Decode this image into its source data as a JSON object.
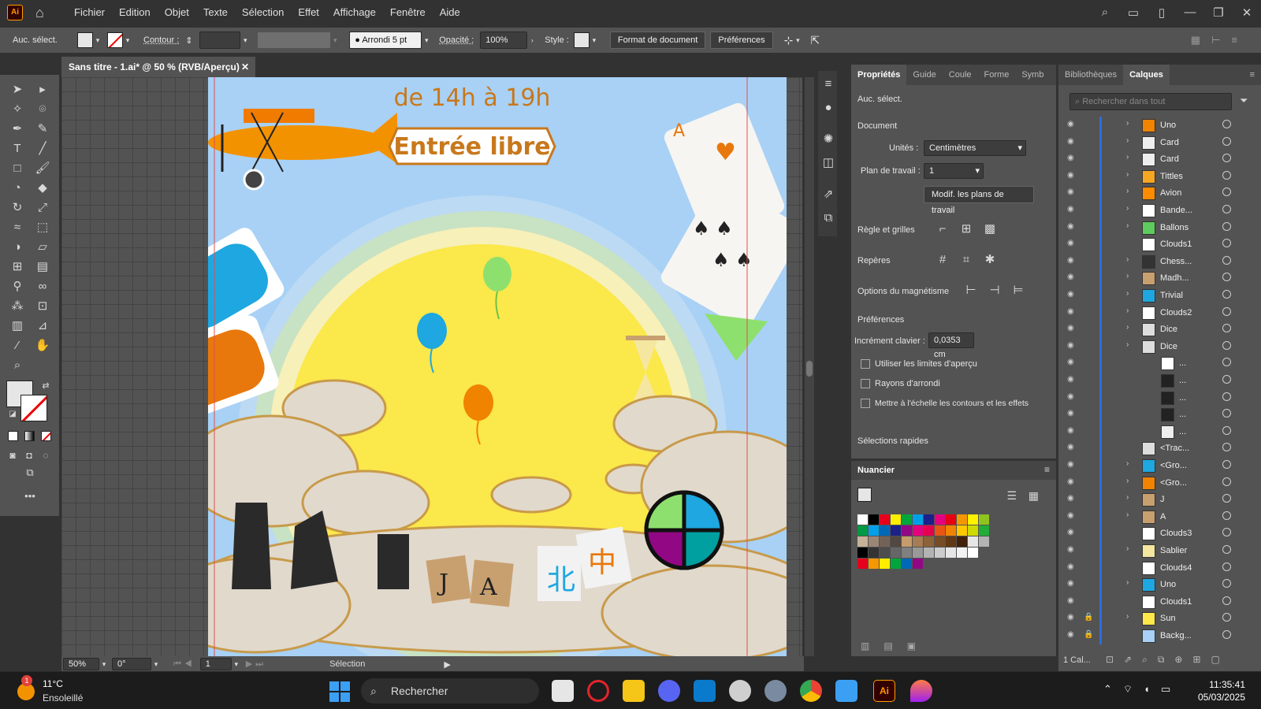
{
  "app": {
    "logo": "Ai",
    "menus": [
      "Fichier",
      "Edition",
      "Objet",
      "Texte",
      "Sélection",
      "Effet",
      "Affichage",
      "Fenêtre",
      "Aide"
    ]
  },
  "control": {
    "selection": "Auc. sélect.",
    "stroke_label": "Contour :",
    "brush": "Arrondi 5 pt",
    "opacity_label": "Opacité :",
    "opacity": "100%",
    "style_label": "Style :",
    "doc_format": "Format de document",
    "prefs": "Préférences"
  },
  "document": {
    "tab": "Sans titre - 1.ai* @ 50 % (RVB/Aperçu)"
  },
  "artwork": {
    "time": "de 14h à 19h",
    "banner": "Entrée libre",
    "tiles": [
      "J",
      "A"
    ],
    "hanzi": [
      "北",
      "中"
    ]
  },
  "status": {
    "zoom": "50%",
    "rotation": "0°",
    "artboard": "1",
    "tool": "Sélection"
  },
  "properties": {
    "tabs": [
      "Propriétés",
      "Guide",
      "Coule",
      "Forme",
      "Symb"
    ],
    "no_sel": "Auc. sélect.",
    "document": "Document",
    "units_label": "Unités :",
    "units": "Centimètres",
    "artboard_label": "Plan de travail :",
    "artboard": "1",
    "edit_artboards": "Modif. les plans de travail",
    "rulers": "Règle et grilles",
    "guides": "Repères",
    "snap": "Options du magnétisme",
    "prefs": "Préférences",
    "key_inc_label": "Incrément clavier :",
    "key_inc": "0,0353 cm",
    "checks": [
      "Utiliser les limites d'aperçu",
      "Rayons d'arrondi",
      "Mettre à l'échelle les contours et les effets"
    ],
    "quick": "Sélections rapides"
  },
  "swatches": {
    "title": "Nuancier",
    "row1": [
      "#ffffff",
      "#000000",
      "#e6001e",
      "#ffed00",
      "#00a63c",
      "#00a0e9",
      "#1d2088",
      "#e4007f",
      "#e60012",
      "#f39800",
      "#fff100",
      "#8fc31f"
    ],
    "row2": [
      "#009944",
      "#00a0e9",
      "#0068b7",
      "#1d2088",
      "#920783",
      "#e4007f",
      "#e5004f",
      "#ea5514",
      "#f08300",
      "#fcc800",
      "#cfdb00",
      "#22ac38"
    ],
    "row3": [
      "#c7b299",
      "#998675",
      "#736357",
      "#534741",
      "#c69c6d",
      "#a67c52",
      "#8c6239",
      "#754c24",
      "#603813",
      "#42210b",
      "#e6e6e6",
      "#b3b3b3"
    ],
    "row4": [
      "#000000",
      "#333333",
      "#4d4d4d",
      "#666666",
      "#808080",
      "#999999",
      "#b3b3b3",
      "#cccccc",
      "#e6e6e6",
      "#f2f2f2",
      "#ffffff"
    ],
    "row5": [
      "#e6001e",
      "#f39800",
      "#ffed00",
      "#00a63c",
      "#0068b7",
      "#920783"
    ]
  },
  "layers_panel": {
    "tabs": [
      "Bibliothèques",
      "Calques"
    ],
    "search": "Rechercher dans tout",
    "count": "1 Cal...",
    "items": [
      {
        "name": "Uno",
        "exp": true,
        "sub": false,
        "c": "#f08300",
        "lock": false
      },
      {
        "name": "Card",
        "exp": true,
        "sub": false,
        "c": "#eeeeee",
        "lock": false
      },
      {
        "name": "Card",
        "exp": true,
        "sub": false,
        "c": "#eeeeee",
        "lock": false
      },
      {
        "name": "Tittles",
        "exp": true,
        "sub": false,
        "c": "#f5a623",
        "lock": false
      },
      {
        "name": "Avion",
        "exp": true,
        "sub": false,
        "c": "#ff8c00",
        "lock": false
      },
      {
        "name": "Bande...",
        "exp": true,
        "sub": false,
        "c": "#ffffff",
        "lock": false
      },
      {
        "name": "Ballons",
        "exp": true,
        "sub": false,
        "c": "#5ecb5e",
        "lock": false
      },
      {
        "name": "Clouds1",
        "exp": false,
        "sub": false,
        "c": "#ffffff",
        "lock": false
      },
      {
        "name": "Chess...",
        "exp": true,
        "sub": false,
        "c": "#333333",
        "lock": false
      },
      {
        "name": "Madh...",
        "exp": true,
        "sub": false,
        "c": "#c8a070",
        "lock": false
      },
      {
        "name": "Trivial",
        "exp": true,
        "sub": false,
        "c": "#1ea7e0",
        "lock": false
      },
      {
        "name": "Clouds2",
        "exp": true,
        "sub": false,
        "c": "#ffffff",
        "lock": false
      },
      {
        "name": "Dice",
        "exp": true,
        "sub": false,
        "c": "#dddddd",
        "lock": false
      },
      {
        "name": "Dice",
        "exp": true,
        "sub": false,
        "c": "#dddddd",
        "lock": false
      },
      {
        "name": "...",
        "exp": false,
        "sub": true,
        "c": "#ffffff",
        "lock": false
      },
      {
        "name": "...",
        "exp": false,
        "sub": true,
        "c": "#222222",
        "lock": false
      },
      {
        "name": "...",
        "exp": false,
        "sub": true,
        "c": "#222222",
        "lock": false
      },
      {
        "name": "...",
        "exp": false,
        "sub": true,
        "c": "#222222",
        "lock": false
      },
      {
        "name": "...",
        "exp": false,
        "sub": true,
        "c": "#eeeeee",
        "lock": false
      },
      {
        "name": "<Trac...",
        "exp": false,
        "sub": false,
        "c": "#dddddd",
        "lock": false
      },
      {
        "name": "<Gro...",
        "exp": true,
        "sub": false,
        "c": "#1ea7e0",
        "lock": false
      },
      {
        "name": "<Gro...",
        "exp": true,
        "sub": false,
        "c": "#f08300",
        "lock": false
      },
      {
        "name": "J",
        "exp": true,
        "sub": false,
        "c": "#c8a070",
        "lock": false
      },
      {
        "name": "A",
        "exp": true,
        "sub": false,
        "c": "#c8a070",
        "lock": false
      },
      {
        "name": "Clouds3",
        "exp": false,
        "sub": false,
        "c": "#ffffff",
        "lock": false
      },
      {
        "name": "Sablier",
        "exp": true,
        "sub": false,
        "c": "#f5e6a0",
        "lock": false
      },
      {
        "name": "Clouds4",
        "exp": false,
        "sub": false,
        "c": "#ffffff",
        "lock": false
      },
      {
        "name": "Uno",
        "exp": true,
        "sub": false,
        "c": "#1ea7e0",
        "lock": false
      },
      {
        "name": "Clouds1",
        "exp": false,
        "sub": false,
        "c": "#ffffff",
        "lock": false
      },
      {
        "name": "Sun",
        "exp": true,
        "sub": false,
        "c": "#ffe94a",
        "lock": true
      },
      {
        "name": "Backg...",
        "exp": false,
        "sub": false,
        "c": "#a8d1f5",
        "lock": true
      }
    ]
  },
  "taskbar": {
    "temp": "11°C",
    "weather": "Ensoleillé",
    "search": "Rechercher",
    "time": "11:35:41",
    "date": "05/03/2025",
    "badge": "1"
  }
}
